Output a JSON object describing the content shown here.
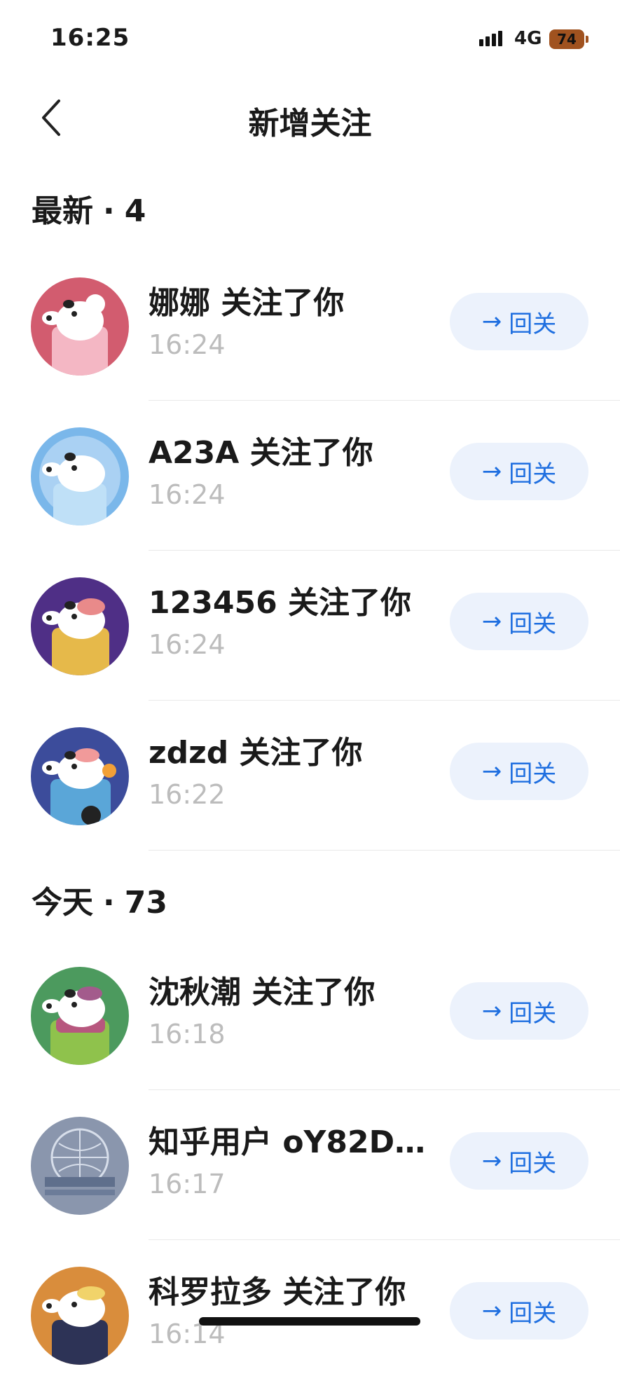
{
  "status": {
    "time": "16:25",
    "network": "4G",
    "battery": "74"
  },
  "nav": {
    "title": "新增关注"
  },
  "sections": [
    {
      "label": "最新",
      "count": "4"
    },
    {
      "label": "今天",
      "count": "73"
    }
  ],
  "follow_button": {
    "label": "回关",
    "arrow": "→"
  },
  "items": [
    {
      "name": "娜娜 关注了你",
      "time": "16:24",
      "bg": "#d25c6f"
    },
    {
      "name": "A23A 关注了你",
      "time": "16:24",
      "bg": "#7ab7ea"
    },
    {
      "name": "123456 关注了你",
      "time": "16:24",
      "bg": "#4f2f86"
    },
    {
      "name": "zdzd 关注了你",
      "time": "16:22",
      "bg": "#3c4c9b"
    },
    {
      "name": "沈秋潮 关注了你",
      "time": "16:18",
      "bg": "#4c9a5e"
    },
    {
      "name": "知乎用户 oY82D...",
      "time": "16:17",
      "bg": "#8a96ad"
    },
    {
      "name": "科罗拉多 关注了你",
      "time": "16:14",
      "bg": "#d98d3c"
    }
  ]
}
